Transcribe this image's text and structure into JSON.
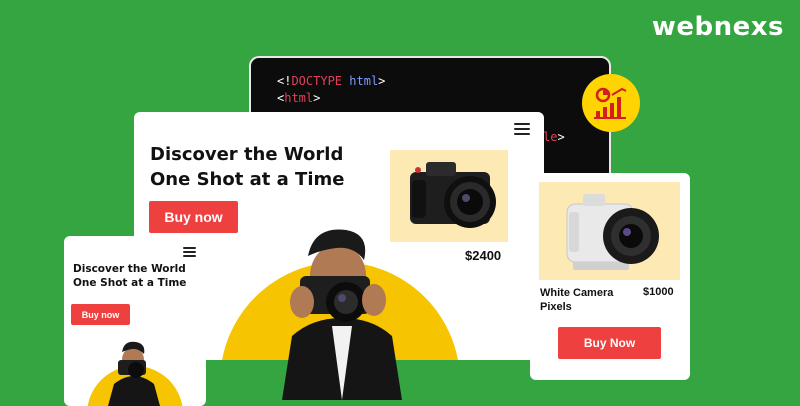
{
  "brand": {
    "name": "webnexs"
  },
  "code": {
    "line1_open": "<!",
    "line1_keyword": "DOCTYPE",
    "line1_attr": "html",
    "line1_close": ">",
    "line2_open": "<",
    "line2_tag": "html",
    "line2_close": ">",
    "fragment_red": "le",
    "fragment_white": ">"
  },
  "desktop": {
    "headline": "Discover the World One Shot at a Time",
    "cta": "Buy now",
    "price": "$2400"
  },
  "mobile": {
    "headline": "Discover the World One Shot at a Time",
    "cta": "Buy now"
  },
  "product": {
    "name": "White Camera Pixels",
    "price": "$1000",
    "cta": "Buy Now"
  },
  "colors": {
    "background": "#34a540",
    "accent_red": "#ef4040",
    "accent_yellow": "#f6c400",
    "product_bg": "#fde9b3"
  },
  "icons": [
    "menu-icon",
    "analytics-chart-icon",
    "camera-icon"
  ]
}
